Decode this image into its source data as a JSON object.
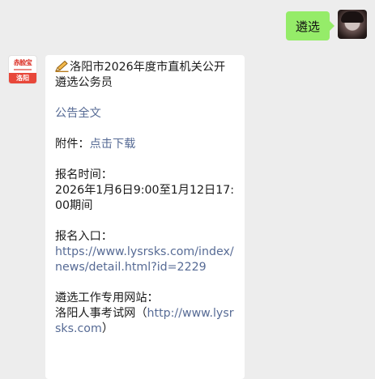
{
  "outgoing": {
    "text": "遴选"
  },
  "incoming": {
    "avatar": {
      "brand_top": "赤脸宝",
      "brand_bottom": "洛阳"
    },
    "title": "洛阳市2026年度市直机关公开遴选公务员",
    "announcement_link": "公告全文",
    "attachment_label": "附件：",
    "attachment_link": "点击下载",
    "reg_time_label": "报名时间：",
    "reg_time_value": "2026年1月6日9:00至1月12日17:00期间",
    "reg_entry_label": "报名入口：",
    "reg_entry_url": "https://www.lysrsks.com/index/news/detail.html?id=2229",
    "website_label": "遴选工作专用网站：",
    "website_name": "洛阳人事考试网（",
    "website_url": "http://www.lysrsks.com",
    "website_close": "）"
  },
  "colors": {
    "background": "#ededed",
    "outgoing_bubble": "#95ec69",
    "incoming_bubble": "#ffffff",
    "link": "#576b95",
    "brand_red": "#d9261c"
  },
  "icons": {
    "title_icon": "pencil-icon"
  }
}
